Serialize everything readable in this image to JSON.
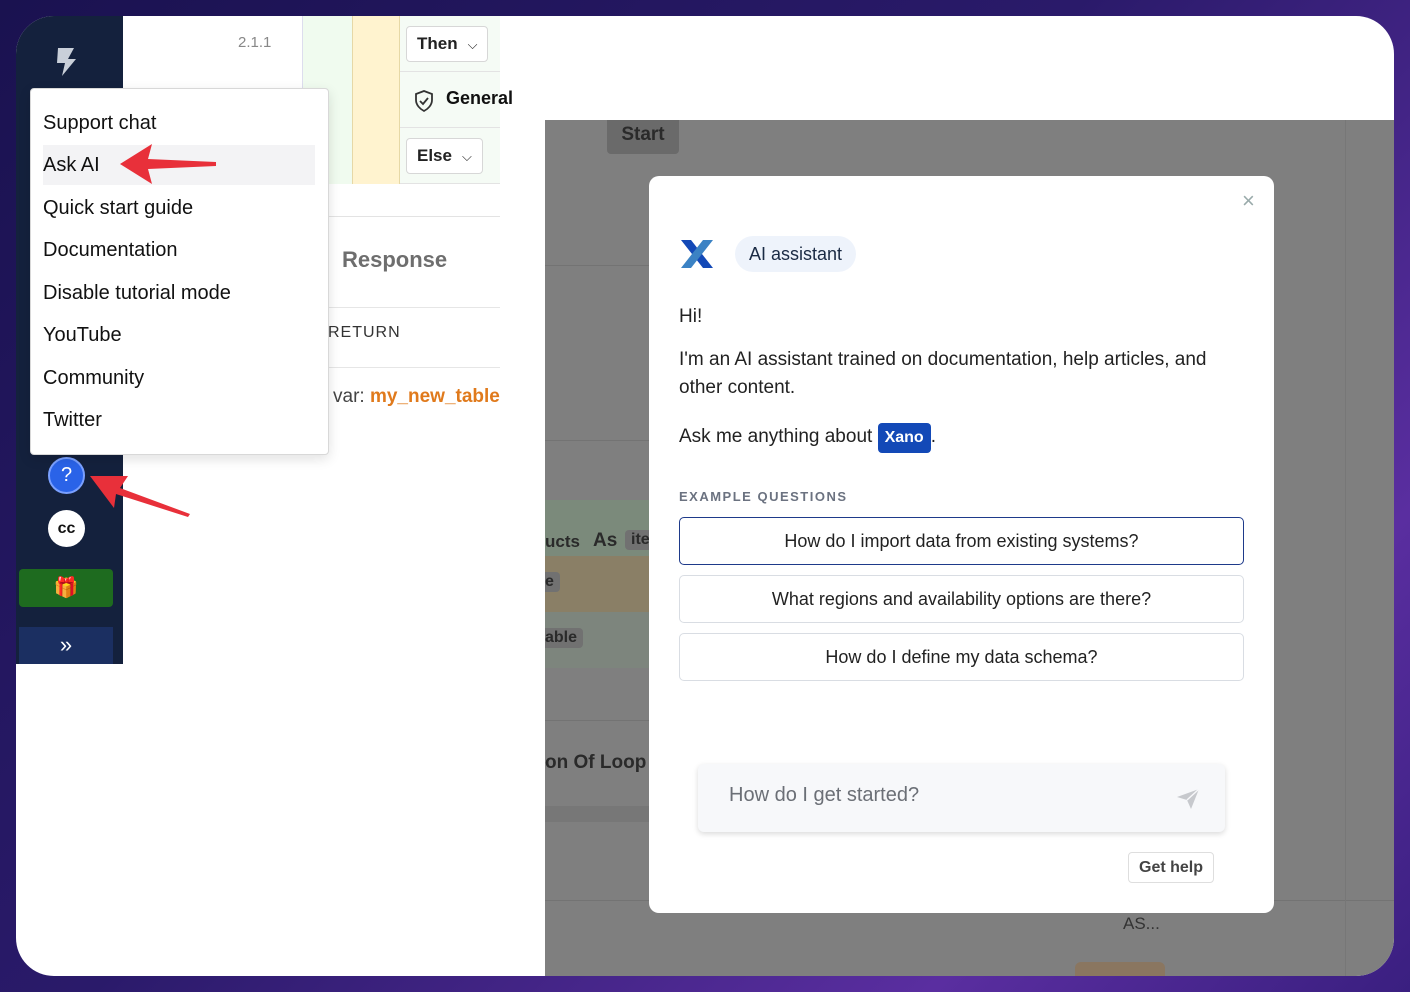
{
  "canvas": {
    "version": "2.1.1",
    "conditions": {
      "then": "Then",
      "general": "General",
      "else": "Else"
    },
    "response": {
      "title": "Response",
      "return_label": "RETURN",
      "var_prefix": "var:",
      "var_name": "my_new_table"
    },
    "start_label": "Start",
    "background_labels": {
      "products": "ucts",
      "as": "As",
      "item": "ite",
      "e": "e",
      "able": "able",
      "end_of_loop": "on Of Loop",
      "as_dots": "AS..."
    }
  },
  "help_menu": {
    "items": [
      {
        "label": "Support chat"
      },
      {
        "label": "Ask AI"
      },
      {
        "label": "Quick start guide"
      },
      {
        "label": "Documentation"
      },
      {
        "label": "Disable tutorial mode"
      },
      {
        "label": "YouTube"
      },
      {
        "label": "Community"
      },
      {
        "label": "Twitter"
      }
    ],
    "active_index": 1
  },
  "rail": {
    "help_icon": "question-circle-icon",
    "cc_label": "cc",
    "gift_icon": "gift-icon",
    "expand_icon": "chevrons-right-icon"
  },
  "ai_modal": {
    "badge": "AI assistant",
    "greeting": "Hi!",
    "intro": "I'm an AI assistant trained on documentation, help articles, and other content.",
    "ask_prefix": "Ask me anything about",
    "product": "Xano",
    "ask_suffix": ".",
    "examples_label": "EXAMPLE QUESTIONS",
    "examples": [
      "How do I import data from existing systems?",
      "What regions and availability options are there?",
      "How do I define my data schema?"
    ],
    "input_placeholder": "How do I get started?",
    "get_help": "Get help"
  },
  "colors": {
    "rail": "#14213d",
    "help_button": "#2a63e8",
    "xano_blue": "#1349b7",
    "annotation_red": "#e8303a",
    "var_orange": "#e07a1c"
  }
}
